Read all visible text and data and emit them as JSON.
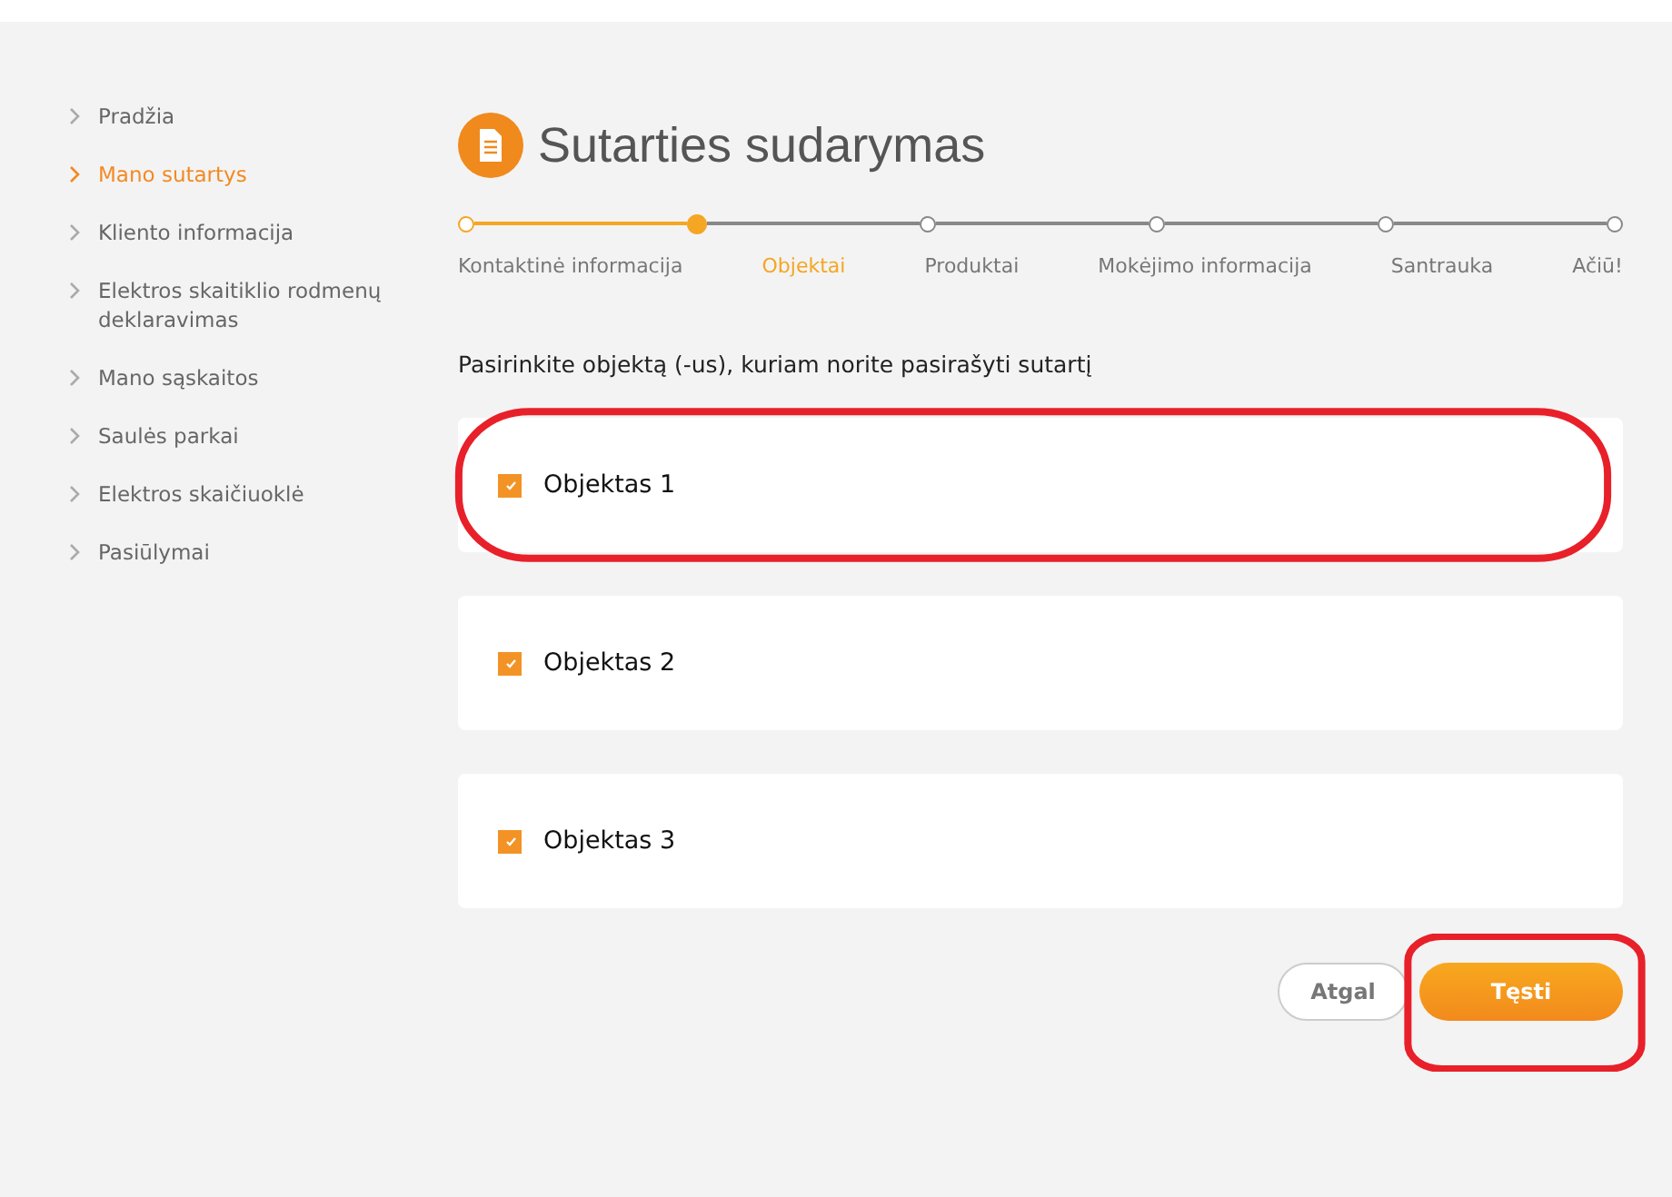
{
  "sidebar": {
    "items": [
      {
        "label": "Pradžia",
        "selected": false
      },
      {
        "label": "Mano sutartys",
        "selected": true
      },
      {
        "label": "Kliento informacija",
        "selected": false
      },
      {
        "label": "Elektros skaitiklio rodmenų deklaravimas",
        "selected": false
      },
      {
        "label": "Mano sąskaitos",
        "selected": false
      },
      {
        "label": "Saulės parkai",
        "selected": false
      },
      {
        "label": "Elektros skaičiuoklė",
        "selected": false
      },
      {
        "label": "Pasiūlymai",
        "selected": false
      }
    ]
  },
  "page_title": "Sutarties sudarymas",
  "steps": [
    {
      "label": "Kontaktinė informacija",
      "done": true,
      "selected": false
    },
    {
      "label": "Objektai",
      "done": false,
      "selected": true
    },
    {
      "label": "Produktai",
      "done": false,
      "selected": false
    },
    {
      "label": "Mokėjimo informacija",
      "done": false,
      "selected": false
    },
    {
      "label": "Santrauka",
      "done": false,
      "selected": false
    },
    {
      "label": "Ačiū!",
      "done": false,
      "selected": false
    }
  ],
  "prompt": "Pasirinkite objektą (-us), kuriam norite pasirašyti sutartį",
  "objects": [
    {
      "label": "Objektas 1",
      "checked": true,
      "circled": true
    },
    {
      "label": "Objektas 2",
      "checked": true,
      "circled": false
    },
    {
      "label": "Objektas 3",
      "checked": true,
      "circled": false
    }
  ],
  "buttons": [
    {
      "label": "Atgal",
      "kind": "secondary",
      "circled": false
    },
    {
      "label": "Tęsti",
      "kind": "primary",
      "circled": true
    }
  ]
}
